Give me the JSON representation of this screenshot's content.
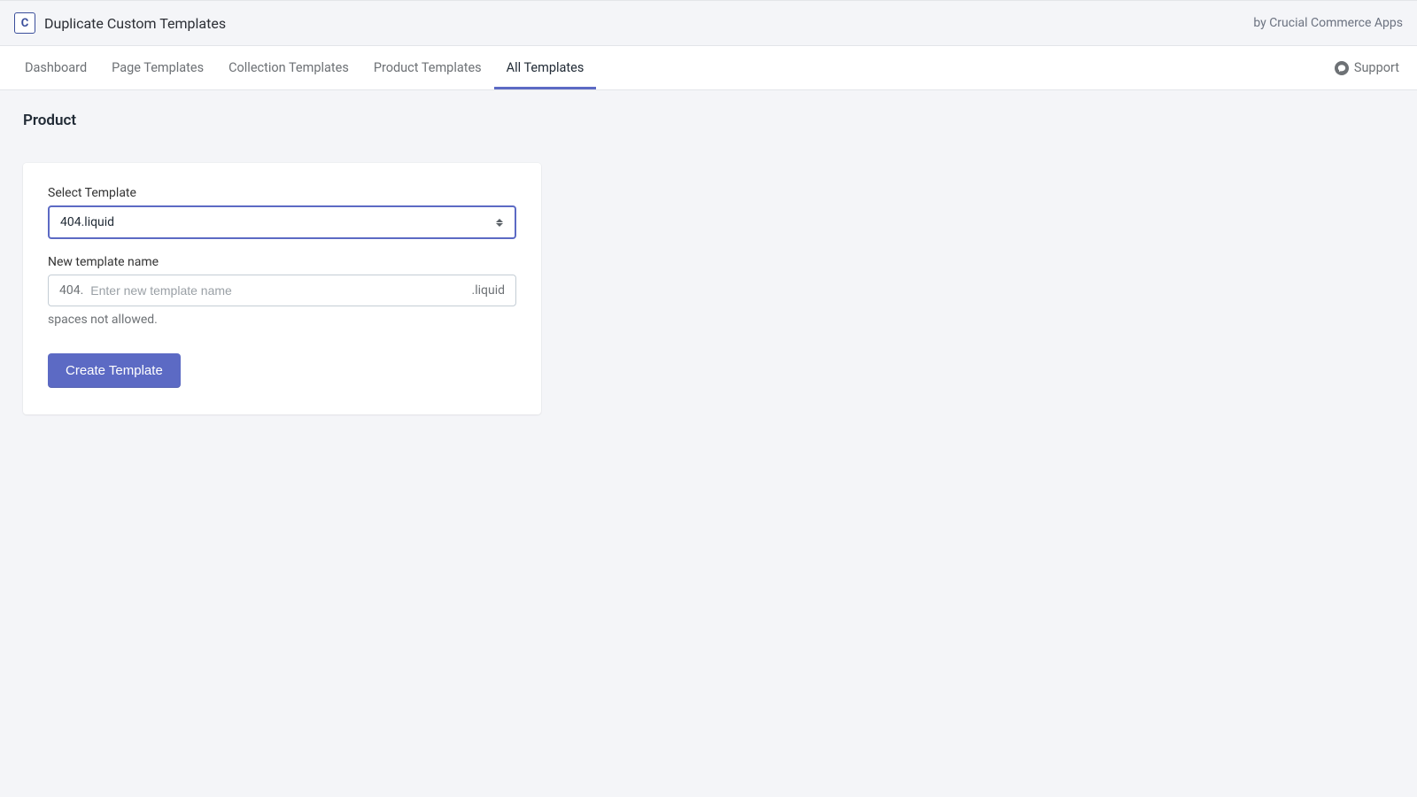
{
  "header": {
    "app_title": "Duplicate Custom Templates",
    "by_line": "by Crucial Commerce Apps",
    "logo_letter": "C"
  },
  "tabs": {
    "items": [
      {
        "label": "Dashboard"
      },
      {
        "label": "Page Templates"
      },
      {
        "label": "Collection Templates"
      },
      {
        "label": "Product Templates"
      },
      {
        "label": "All Templates"
      }
    ],
    "support_label": "Support"
  },
  "page": {
    "title": "Product"
  },
  "form": {
    "select_label": "Select Template",
    "select_value": "404.liquid",
    "name_label": "New template name",
    "name_prefix": "404.",
    "name_placeholder": "Enter new template name",
    "name_suffix": ".liquid",
    "help_text": "spaces not allowed.",
    "submit_label": "Create Template"
  }
}
